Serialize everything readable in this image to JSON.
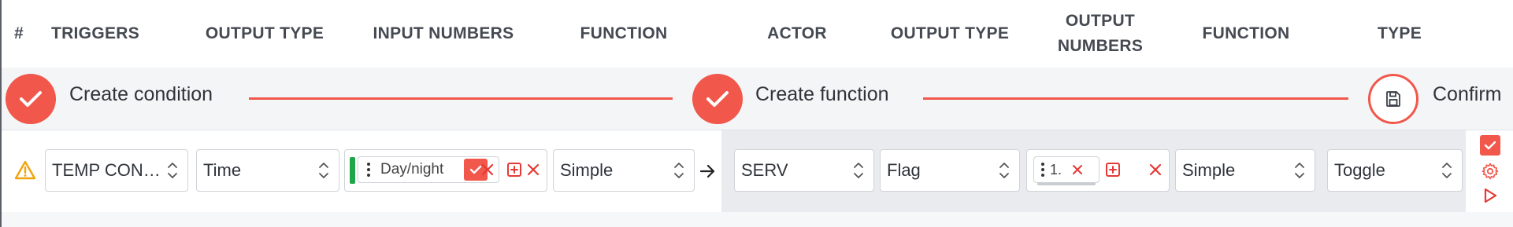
{
  "header": {
    "col_index": "#",
    "col_triggers": "TRIGGERS",
    "col_output_type_1": "OUTPUT TYPE",
    "col_input_numbers": "INPUT NUMBERS",
    "col_function_1": "FUNCTION",
    "col_actor": "ACTOR",
    "col_output_type_2": "OUTPUT TYPE",
    "col_output_numbers_line1": "OUTPUT",
    "col_output_numbers_line2": "NUMBERS",
    "col_function_2": "FUNCTION",
    "col_type": "TYPE"
  },
  "stepper": {
    "step1_label": "Create condition",
    "step2_label": "Create function",
    "step3_label": "Confirm"
  },
  "row": {
    "trigger_value": "TEMP CONT...",
    "output_type_value": "Time",
    "input_chip_label": "Day/night",
    "function_value": "Simple",
    "actor_value": "SERV",
    "actor_output_type_value": "Flag",
    "output_chip_label": "1.",
    "actor_function_value": "Simple",
    "type_value": "Toggle"
  },
  "icons": {
    "warning": "warning-icon",
    "check": "check-icon",
    "save": "save-icon",
    "settings": "gear-icon",
    "play": "play-icon"
  },
  "colors": {
    "accent": "#f1574b",
    "warning": "#f0a30a",
    "chip_green": "#1fa64a",
    "red": "#e53935"
  }
}
